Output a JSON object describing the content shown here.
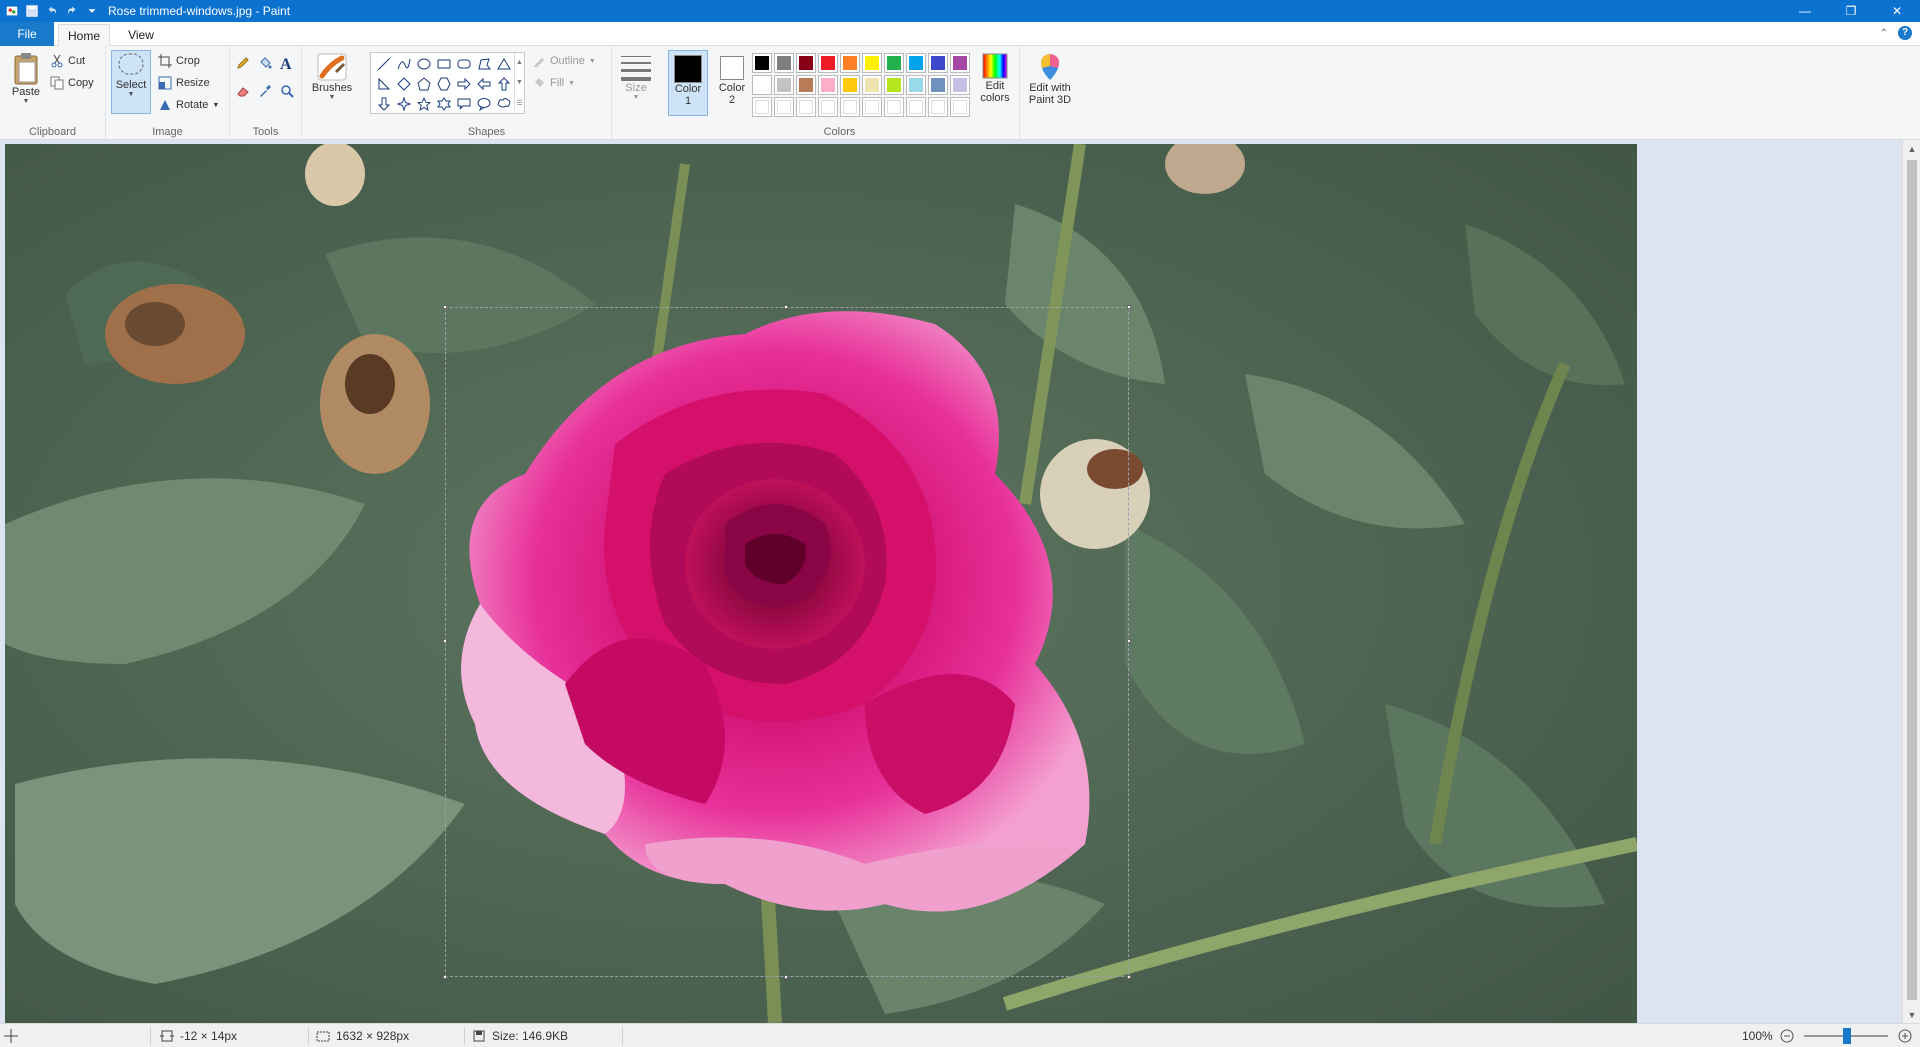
{
  "window": {
    "title": "Rose trimmed-windows.jpg - Paint",
    "minimize_glyph": "—",
    "restore_glyph": "❐",
    "close_glyph": "✕"
  },
  "tabs": {
    "file": "File",
    "home": "Home",
    "view": "View",
    "help_glyph": "?",
    "collapse_glyph": "⌃"
  },
  "clipboard": {
    "paste": "Paste",
    "cut": "Cut",
    "copy": "Copy",
    "label": "Clipboard"
  },
  "image_group": {
    "select": "Select",
    "crop": "Crop",
    "resize": "Resize",
    "rotate": "Rotate",
    "label": "Image"
  },
  "tools": {
    "label": "Tools",
    "text_glyph": "A"
  },
  "brushes": {
    "label": "Brushes"
  },
  "shapes": {
    "label": "Shapes",
    "outline": "Outline",
    "fill": "Fill",
    "size": "Size"
  },
  "colors": {
    "color1": "Color\n1",
    "color1_line1": "Color",
    "color1_line2": "1",
    "color2_line1": "Color",
    "color2_line2": "2",
    "edit_line1": "Edit",
    "edit_line2": "colors",
    "label": "Colors",
    "color1_value": "#000000",
    "color2_value": "#ffffff",
    "palette_row1": [
      "#000000",
      "#7f7f7f",
      "#880015",
      "#ed1c24",
      "#ff7f27",
      "#fff200",
      "#22b14c",
      "#00a2e8",
      "#3f48cc",
      "#a349a4"
    ],
    "palette_row2": [
      "#ffffff",
      "#c3c3c3",
      "#b97a57",
      "#ffaec9",
      "#ffc90e",
      "#efe4b0",
      "#b5e61d",
      "#99d9ea",
      "#7092be",
      "#c8bfe7"
    ],
    "palette_row3": [
      "#ffffff",
      "#ffffff",
      "#ffffff",
      "#ffffff",
      "#ffffff",
      "#ffffff",
      "#ffffff",
      "#ffffff",
      "#ffffff",
      "#ffffff"
    ]
  },
  "paint3d": {
    "line1": "Edit with",
    "line2": "Paint 3D"
  },
  "status": {
    "cursor_pos": "-12 × 14px",
    "selection_size": "1632 × 928px",
    "file_size": "Size: 146.9KB",
    "zoom": "100%"
  }
}
